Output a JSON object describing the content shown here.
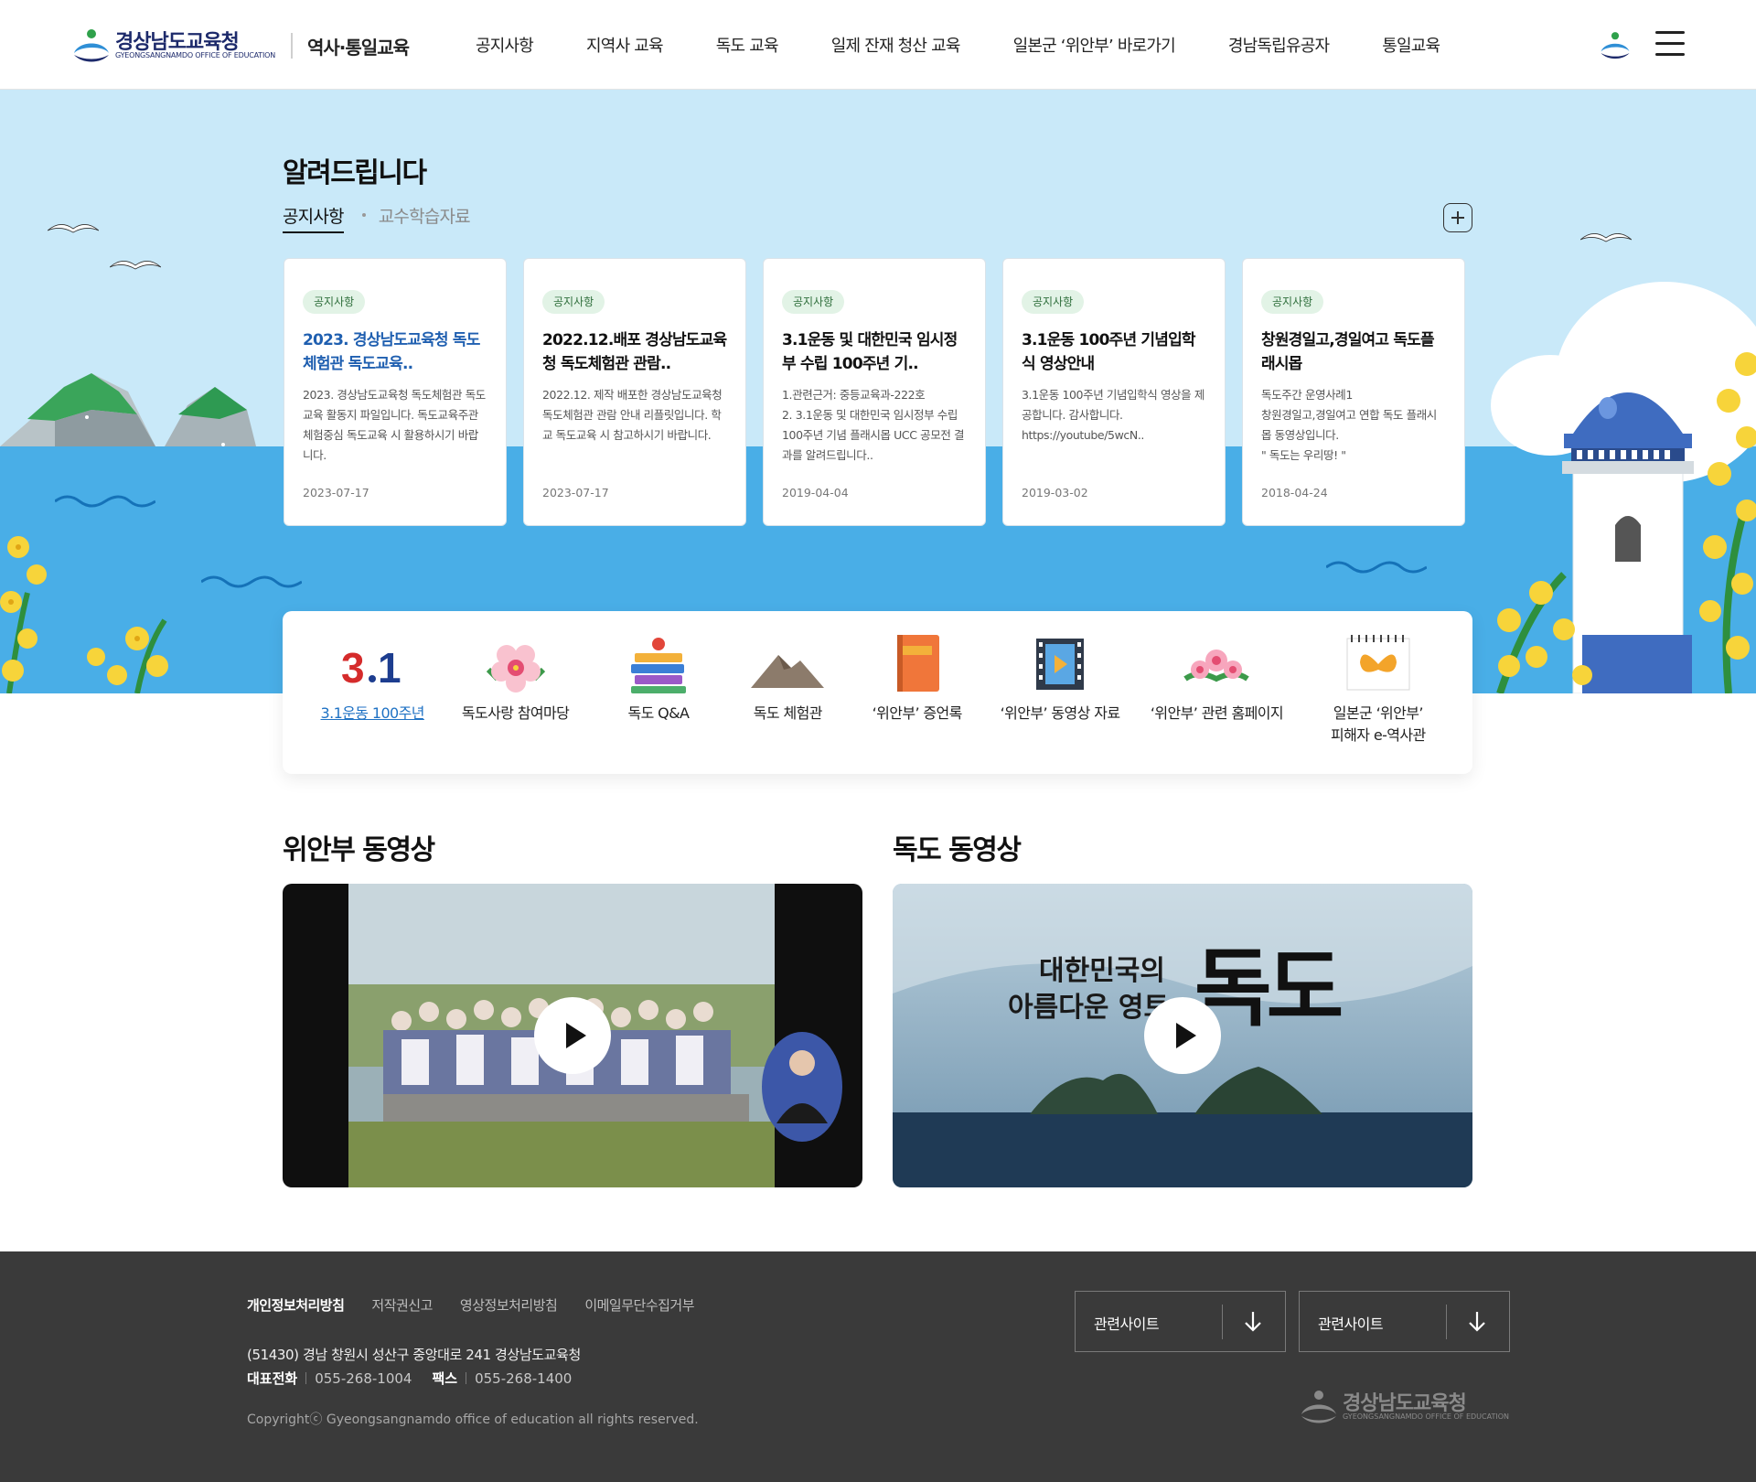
{
  "header": {
    "logo_ko": "경상남도교육청",
    "logo_en": "GYEONGSANGNAMDO OFFICE OF EDUCATION",
    "site_name": "역사·통일교육",
    "nav": [
      "공지사항",
      "지역사 교육",
      "독도 교육",
      "일제 잔재 청산 교육",
      "일본군 ‘위안부’ 바로가기",
      "경남독립유공자",
      "통일교육"
    ]
  },
  "notice": {
    "title": "알려드립니다",
    "tab_active": "공지사항",
    "tab_other": "교수학습자료",
    "cards": [
      {
        "tag": "공지사항",
        "title": "2023. 경상남도교육청 독도체험관 독도교육..",
        "desc": "2023. 경상남도교육청 독도체험관 독도교육 활동지 파일입니다. 독도교육주관 체험중심 독도교육 시 활용하시기 바랍니다.",
        "date": "2023-07-17"
      },
      {
        "tag": "공지사항",
        "title": "2022.12.배포 경상남도교육청 독도체험관 관람..",
        "desc": "2022.12. 제작 배포한 경상남도교육청 독도체험관 관람 안내 리플릿입니다. 학교 독도교육 시 참고하시기 바랍니다.",
        "date": "2023-07-17"
      },
      {
        "tag": "공지사항",
        "title": "3.1운동 및 대한민국 임시정부 수립 100주년 기..",
        "desc": "1.관련근거: 중등교육과-222호\n2. 3.1운동 및 대한민국 임시정부 수립 100주년 기념 플래시몹 UCC 공모전 결과를 알려드립니다..",
        "date": "2019-04-04"
      },
      {
        "tag": "공지사항",
        "title": "3.1운동 100주년 기념입학식 영상안내",
        "desc": "3.1운동 100주년 기념입학식 영상을 제공합니다. 감사합니다. https://youtube/5wcN..",
        "date": "2019-03-02"
      },
      {
        "tag": "공지사항",
        "title": "창원경일고,경일여고 독도플래시몹",
        "desc": "독도주간 운영사례1\n창원경일고,경일여고  연합 독도 플래시몹 동영상입니다.\n\" 독도는 우리땅! \"",
        "date": "2018-04-24"
      }
    ]
  },
  "quick_menu": [
    {
      "label": "3.1운동 100주년",
      "icon": "31-movement-icon"
    },
    {
      "label": "독도사랑 참여마당",
      "icon": "flower-icon"
    },
    {
      "label": "독도 Q&A",
      "icon": "books-icon"
    },
    {
      "label": "독도 체험관",
      "icon": "mountain-icon"
    },
    {
      "label": "‘위안부’ 증언록",
      "icon": "book-icon"
    },
    {
      "label": "‘위안부’ 동영상 자료",
      "icon": "film-icon"
    },
    {
      "label": "‘위안부’ 관련 홈페이지",
      "icon": "flowers-icon"
    },
    {
      "label": "일본군 ‘위안부’\n피해자 e-역사관",
      "icon": "butterfly-icon"
    }
  ],
  "videos": {
    "left_title": "위안부 동영상",
    "right_title": "독도 동영상",
    "right_overlay_line1": "대한민국의",
    "right_overlay_line2": "아름다운 영토",
    "right_overlay_big": "독도"
  },
  "footer": {
    "links": [
      "개인정보처리방침",
      "저작권신고",
      "영상정보처리방침",
      "이메일무단수집거부"
    ],
    "address": "(51430) 경남 창원시 성산구 중앙대로 241 경상남도교육청",
    "phone_label": "대표전화",
    "phone": "055-268-1004",
    "fax_label": "팩스",
    "fax": "055-268-1400",
    "copyright": "Copyrightⓒ Gyeongsangnamdo office of education all rights reserved.",
    "select1": "관련사이트",
    "select2": "관련사이트",
    "logo_ko": "경상남도교육청",
    "logo_en": "GYEONGSANGNAMDO OFFICE OF EDUCATION"
  },
  "colors": {
    "hero_sky": "#c9e9f9",
    "hero_sea": "#49aee7",
    "footer_bg": "#3a3a3a",
    "accent_blue": "#1f5fb0",
    "tag_bg": "#e2f3e6"
  }
}
